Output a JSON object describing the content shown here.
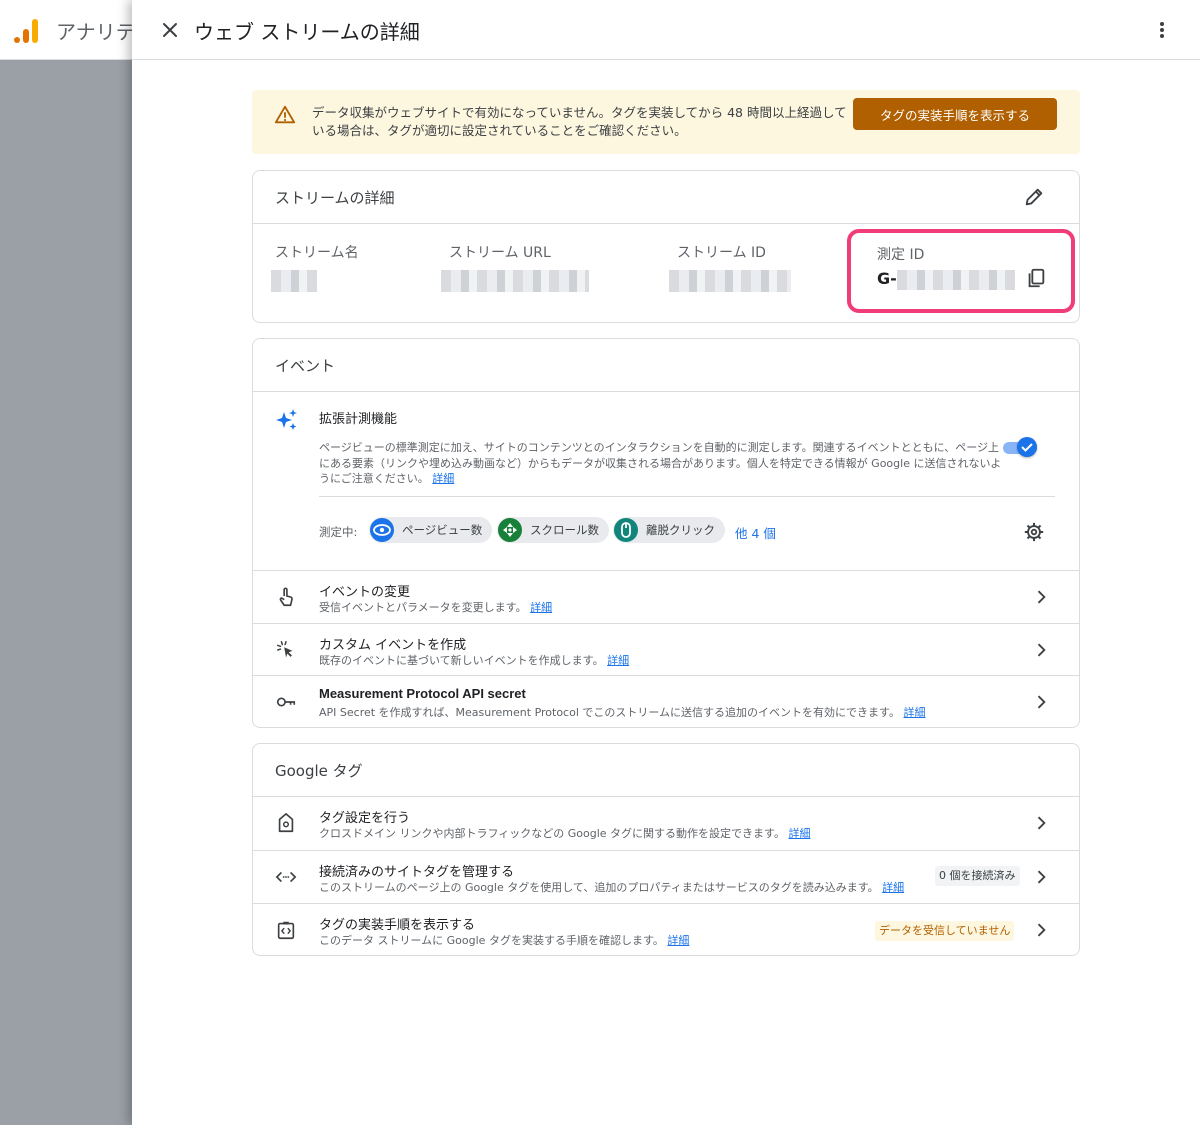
{
  "background": {
    "app_title": "アナリテ"
  },
  "panel": {
    "title": "ウェブ ストリームの詳細"
  },
  "banner": {
    "text": "データ収集がウェブサイトで有効になっていません。タグを実装してから 48 時間以上経過している場合は、タグが適切に設定されていることをご確認ください。",
    "button_label": "タグの実装手順を表示する"
  },
  "stream_details": {
    "title": "ストリームの詳細",
    "fields": [
      {
        "label": "ストリーム名"
      },
      {
        "label": "ストリーム URL"
      },
      {
        "label": "ストリーム ID"
      }
    ],
    "measurement": {
      "label": "測定 ID",
      "prefix": "G-"
    }
  },
  "events": {
    "title": "イベント",
    "enhanced": {
      "title": "拡張計測機能",
      "description": "ページビューの標準測定に加え、サイトのコンテンツとのインタラクションを自動的に測定します。関連するイベントとともに、ページ上にある要素（リンクや埋め込み動画など）からもデータが収集される場合があります。個人を特定できる情報が Google に送信されないようにご注意ください。",
      "link": "詳細",
      "enabled": true
    },
    "measuring_label": "測定中:",
    "chips": [
      {
        "label": "ページビュー数",
        "color": "#1a73e8"
      },
      {
        "label": "スクロール数",
        "color": "#188038"
      },
      {
        "label": "離脱クリック",
        "color": "#12857a"
      }
    ],
    "more_link": "他 4 個",
    "rows": [
      {
        "title": "イベントの変更",
        "desc": "受信イベントとパラメータを変更します。",
        "link": "詳細"
      },
      {
        "title": "カスタム イベントを作成",
        "desc": "既存のイベントに基づいて新しいイベントを作成します。",
        "link": "詳細"
      },
      {
        "title": "Measurement Protocol API secret",
        "desc": "API Secret を作成すれば、Measurement Protocol でこのストリームに送信する追加のイベントを有効にできます。",
        "link": "詳細"
      }
    ]
  },
  "google_tag": {
    "title": "Google タグ",
    "rows": [
      {
        "title": "タグ設定を行う",
        "desc": "クロスドメイン リンクや内部トラフィックなどの Google タグに関する動作を設定できます。",
        "link": "詳細"
      },
      {
        "title": "接続済みのサイトタグを管理する",
        "desc": "このストリームのページ上の Google タグを使用して、追加のプロパティまたはサービスのタグを読み込みます。",
        "link": "詳細",
        "badge": "0 個を接続済み"
      },
      {
        "title": "タグの実装手順を表示する",
        "desc": "このデータ ストリームに Google タグを実装する手順を確認します。",
        "link": "詳細",
        "badge": "データを受信していません"
      }
    ]
  },
  "colors": {
    "accent": "#1a73e8",
    "highlight": "#f03c78",
    "warning_button": "#b06000"
  }
}
